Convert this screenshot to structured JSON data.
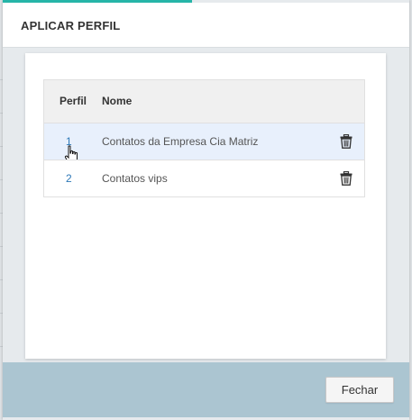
{
  "dialog": {
    "title": "APLICAR PERFIL"
  },
  "table": {
    "columns": {
      "perfil": "Perfil",
      "nome": "Nome"
    },
    "rows": [
      {
        "perfil": "1",
        "nome": "Contatos da Empresa Cia Matriz"
      },
      {
        "perfil": "2",
        "nome": "Contatos vips"
      }
    ]
  },
  "footer": {
    "close_label": "Fechar"
  },
  "icons": {
    "row_action": "trash-icon",
    "pointer": "hand-cursor-icon"
  },
  "colors": {
    "accent": "#26b5a8",
    "link": "#2d78b7",
    "row_highlight": "#e8f0fc",
    "footer_bg": "#abc5d1"
  }
}
